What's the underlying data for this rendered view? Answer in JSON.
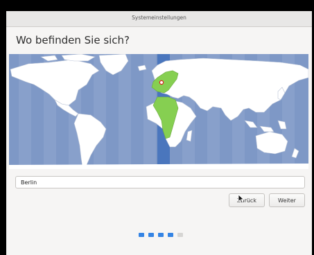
{
  "window": {
    "title": "Systemeinstellungen"
  },
  "page": {
    "heading": "Wo befinden Sie sich?"
  },
  "map": {
    "selected_timezone": "Europe/Berlin",
    "colors": {
      "ocean": "#7e98c6",
      "land": "#ffffff",
      "selected_zone": "#86cf51",
      "highlight_band": "#4a76bd",
      "marker": "#e01b24"
    }
  },
  "location": {
    "value": "Berlin"
  },
  "buttons": {
    "back": "Zurück",
    "next": "Weiter"
  },
  "progress": {
    "steps": 5,
    "current": 4
  }
}
